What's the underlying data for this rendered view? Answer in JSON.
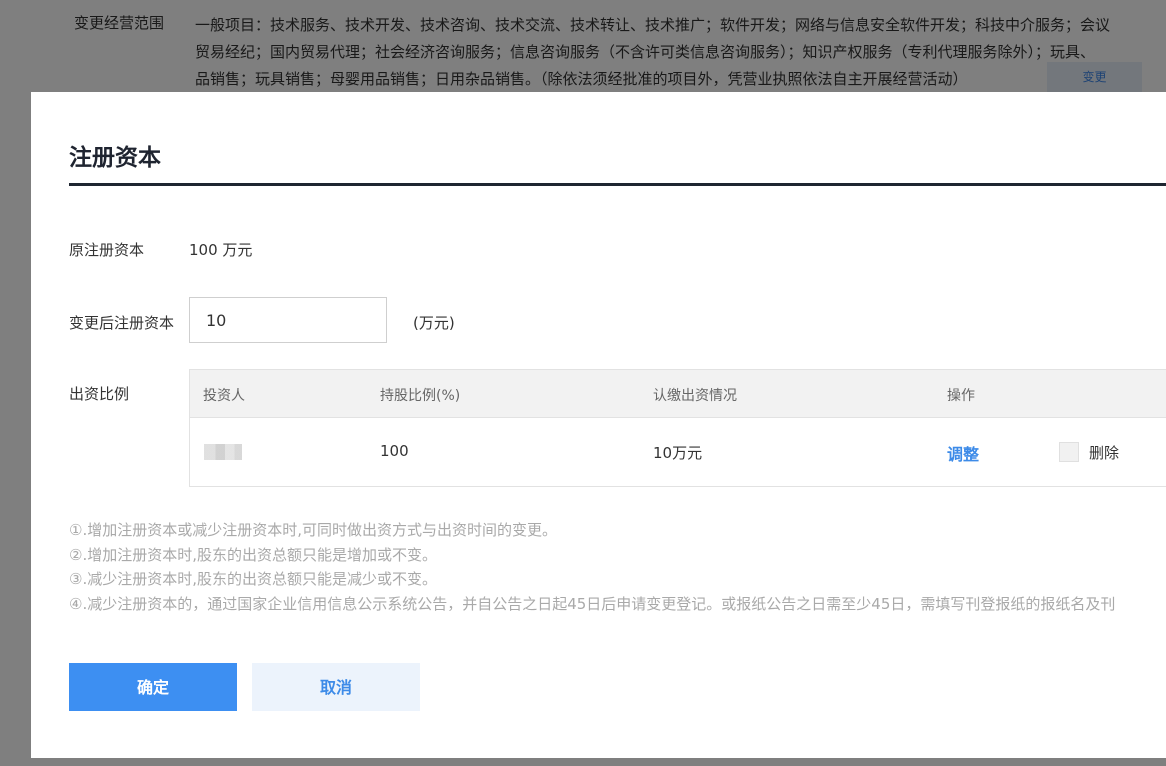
{
  "background": {
    "label": "变更经营范围",
    "lines": [
      "一般项目：技术服务、技术开发、技术咨询、技术交流、技术转让、技术推广；软件开发；网络与信息安全软件开发；科技中介服务；会议",
      "贸易经纪；国内贸易代理；社会经济咨询服务；信息咨询服务（不含许可类信息咨询服务）；知识产权服务（专利代理服务除外）；玩具、",
      "品销售；玩具销售；母婴用品销售；日用杂品销售。（除依法须经批准的项目外，凭营业执照依法自主开展经营活动）"
    ],
    "change_button": "变更"
  },
  "modal": {
    "title": "注册资本",
    "original_label": "原注册资本",
    "original_value": "100 万元",
    "new_label": "变更后注册资本",
    "new_value": "10",
    "unit": "(万元)",
    "ratio_label": "出资比例",
    "table": {
      "headers": [
        "投资人",
        "持股比例(%)",
        "认缴出资情况",
        "操作"
      ],
      "rows": [
        {
          "investor": "",
          "share": "100",
          "subscribed": "10万元",
          "action": "调整",
          "delete_label": "删除"
        }
      ]
    },
    "notes": [
      "①.增加注册资本或减少注册资本时,可同时做出资方式与出资时间的变更。",
      "②.增加注册资本时,股东的出资总额只能是增加或不变。",
      "③.减少注册资本时,股东的出资总额只能是减少或不变。",
      "④.减少注册资本的，通过国家企业信用信息公示系统公告，并自公告之日起45日后申请变更登记。或报纸公告之日需至少45日，需填写刊登报纸的报纸名及刊"
    ],
    "confirm_button": "确定",
    "cancel_button": "取消"
  }
}
